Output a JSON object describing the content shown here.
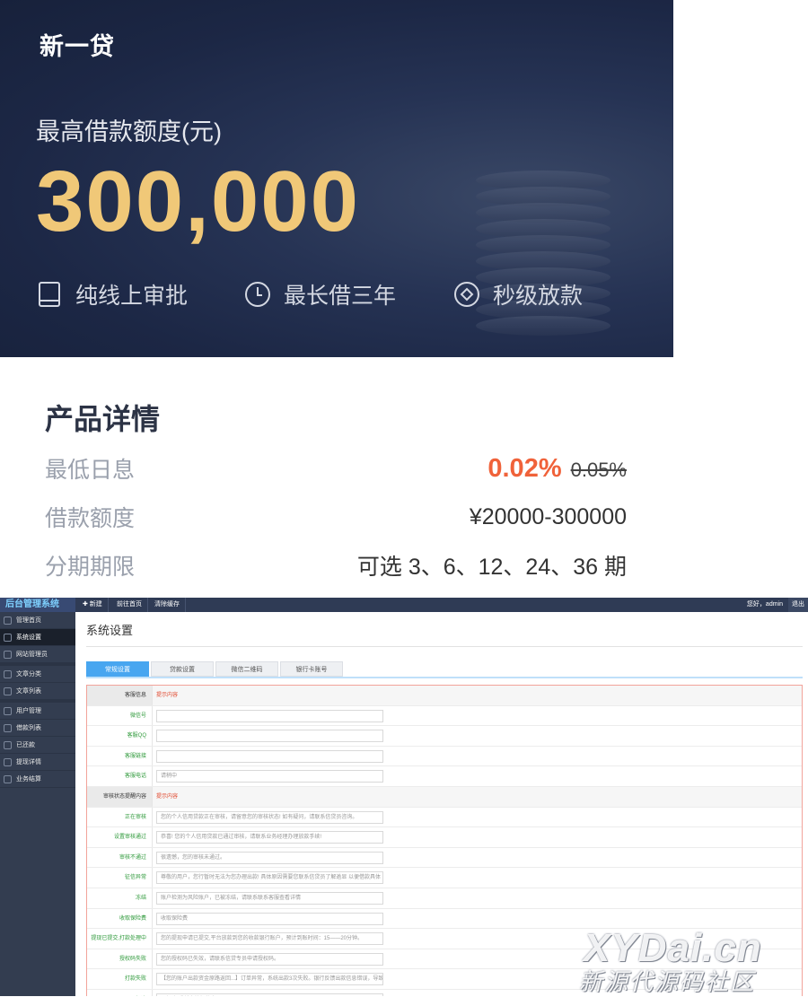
{
  "hero": {
    "brand": "新一贷",
    "limit_label": "最高借款额度(元)",
    "limit_amount": "300,000",
    "features": [
      {
        "icon": "tablet-icon",
        "label": "纯线上审批"
      },
      {
        "icon": "clock-icon",
        "label": "最长借三年"
      },
      {
        "icon": "diamond-coin-icon",
        "label": "秒级放款"
      }
    ]
  },
  "details": {
    "title": "产品详情",
    "rows": [
      {
        "label": "最低日息",
        "value": "0.02%",
        "old_value": "0.05%"
      },
      {
        "label": "借款额度",
        "value": "¥20000-300000"
      },
      {
        "label": "分期期限",
        "value": "可选 3、6、12、24、36 期"
      }
    ]
  },
  "admin": {
    "logo": "后台管理系统",
    "top_buttons": [
      "✚ 新建",
      "前往首页",
      "清除缓存"
    ],
    "greeting": "您好，admin",
    "logout": "退出",
    "sidebar": [
      {
        "label": "管理首页",
        "active": false
      },
      {
        "label": "系统设置",
        "active": true
      },
      {
        "label": "网站管理员",
        "active": false
      },
      {
        "label": "文章分类",
        "active": false
      },
      {
        "label": "文章列表",
        "active": false
      },
      {
        "label": "用户管理",
        "active": false
      },
      {
        "label": "借款列表",
        "active": false
      },
      {
        "label": "已还款",
        "active": false
      },
      {
        "label": "提现详情",
        "active": false
      },
      {
        "label": "业务结算",
        "active": false
      }
    ],
    "page_title": "系统设置",
    "tabs": [
      "常规设置",
      "贷款设置",
      "微信二维码",
      "银行卡账号"
    ],
    "form_rows": [
      {
        "type": "section",
        "label": "客服信息",
        "hint": "提示内容"
      },
      {
        "type": "field",
        "label": "微信号",
        "value": ""
      },
      {
        "type": "field",
        "label": "客服QQ",
        "value": ""
      },
      {
        "type": "field",
        "label": "客服链接",
        "value": ""
      },
      {
        "type": "field",
        "label": "客服电话",
        "value": "请稍中"
      },
      {
        "type": "section",
        "label": "审核状态提醒内容",
        "hint": "提示内容"
      },
      {
        "type": "field",
        "label": "正在审核",
        "value": "您的个人信用贷款正在审核，请留意您的审核状态! 如有疑问，请联系信贷员咨询。"
      },
      {
        "type": "field",
        "label": "设置审核通过",
        "value": "恭喜! 您的个人信用贷款已通过审核，请联系业务经理办理放款手续!"
      },
      {
        "type": "field",
        "label": "审核不通过",
        "value": "很遗憾，您的审核未通过。"
      },
      {
        "type": "field",
        "label": "征信异常",
        "value": "尊敬的用户，您行暂时无法为您办理出款! 具体原因需要您联系信贷员了解逾显 以便借款具体"
      },
      {
        "type": "field",
        "label": "冻结",
        "value": "账户检测为风险账户，已被冻结，请联系联系客服查看详情"
      },
      {
        "type": "field",
        "label": "收取保险费",
        "value": "收取保险费"
      },
      {
        "type": "field",
        "label": "提现已提交,打款处理中",
        "value": "您的提现申请已提交,平台放款到您的收款银行账户，预计到账时间：15——20分钟。"
      },
      {
        "type": "field",
        "label": "授权码失败",
        "value": "您的授权码已失效，请联系信贷专员申请授权码。"
      },
      {
        "type": "field",
        "label": "打款失败",
        "value": "【您的账户出款资金原路返回...】订单异常，系统出款3次失败。银行反馈出款信息错误，导致打"
      },
      {
        "type": "field",
        "label": "解冻",
        "value": "已解冻,重新审核打款中"
      }
    ]
  },
  "watermark": {
    "line1": "XYDai.cn",
    "line2": "新源代源码社区"
  }
}
